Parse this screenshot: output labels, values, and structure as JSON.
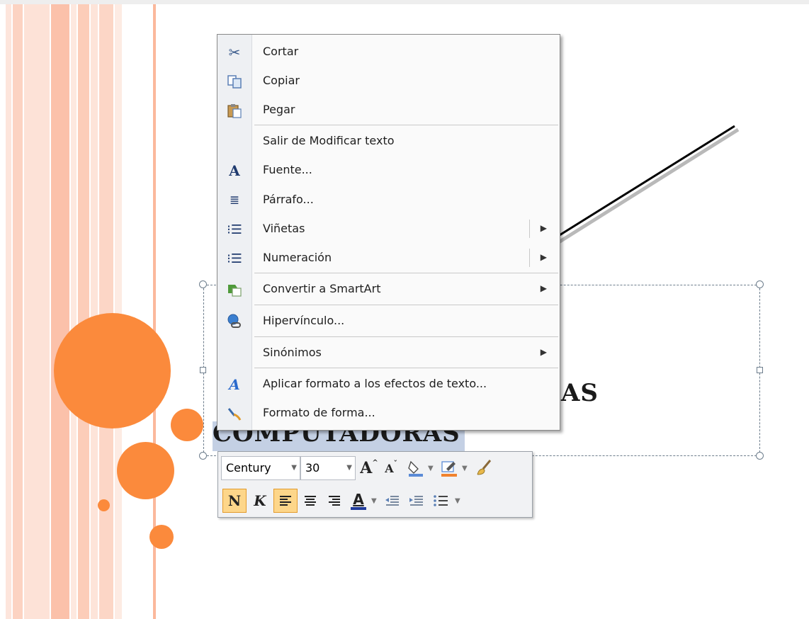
{
  "slide": {
    "title_line1_end": "AS",
    "title_line2": "COMPUTADORAS",
    "colors": {
      "accent": "#fb8a3c",
      "stripe": "#fcc9b3",
      "selection": "#c4d0e4"
    }
  },
  "context_menu": {
    "items": [
      {
        "label": "Cortar",
        "icon": "scissors-icon",
        "submenu": false
      },
      {
        "label": "Copiar",
        "icon": "copy-icon",
        "submenu": false
      },
      {
        "label": "Pegar",
        "icon": "paste-icon",
        "submenu": false
      },
      {
        "label": "Salir de Modificar texto",
        "icon": "",
        "submenu": false
      },
      {
        "label": "Fuente...",
        "icon": "font-icon",
        "submenu": false
      },
      {
        "label": "Párrafo...",
        "icon": "paragraph-icon",
        "submenu": false
      },
      {
        "label": "Viñetas",
        "icon": "bullets-icon",
        "submenu": true
      },
      {
        "label": "Numeración",
        "icon": "numbering-icon",
        "submenu": true
      },
      {
        "label": "Convertir a SmartArt",
        "icon": "smartart-icon",
        "submenu": true
      },
      {
        "label": "Hipervínculo...",
        "icon": "hyperlink-icon",
        "submenu": false
      },
      {
        "label": "Sinónimos",
        "icon": "",
        "submenu": true
      },
      {
        "label": "Aplicar formato a los efectos de texto...",
        "icon": "text-effects-icon",
        "submenu": false
      },
      {
        "label": "Formato de forma...",
        "icon": "format-shape-icon",
        "submenu": false
      }
    ]
  },
  "mini_toolbar": {
    "font_name": "Century",
    "font_size": "30",
    "bold_label": "N",
    "italic_label": "K",
    "font_color_label": "A",
    "grow_font_label": "A",
    "shrink_font_label": "A"
  }
}
